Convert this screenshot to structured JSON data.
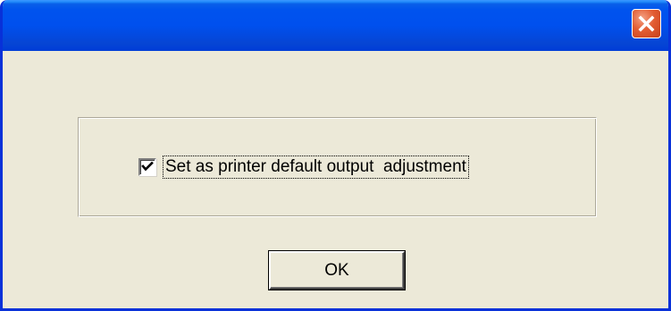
{
  "window": {
    "title": "",
    "close_icon": "close-icon",
    "titlebar_color": "#0053ee",
    "body_color": "#ece9d8",
    "close_color": "#e35d33"
  },
  "options": {
    "checkbox": {
      "label": "Set as printer default output  adjustment",
      "checked": true,
      "icon": "checkmark-icon"
    }
  },
  "buttons": {
    "ok_label": "OK"
  }
}
